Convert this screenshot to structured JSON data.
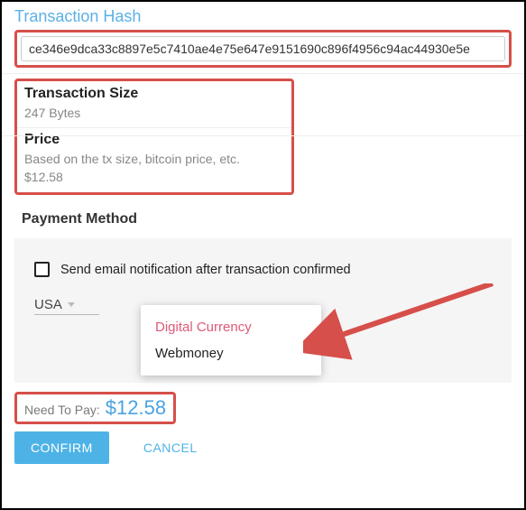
{
  "hash": {
    "label": "Transaction Hash",
    "value": "ce346e9dca33c8897e5c7410ae4e75e647e9151690c896f4956c94ac44930e5e"
  },
  "size": {
    "label": "Transaction Size",
    "value": "247 Bytes"
  },
  "price": {
    "label": "Price",
    "desc": "Based on the tx size, bitcoin price, etc.",
    "value": "$12.58"
  },
  "payment_method": {
    "label": "Payment Method",
    "checkbox_label": "Send email notification after transaction confirmed",
    "country": "USA",
    "options": [
      "Digital Currency",
      "Webmoney"
    ],
    "selected": "Digital Currency"
  },
  "need_pay": {
    "label": "Need To Pay:",
    "value": "$12.58"
  },
  "buttons": {
    "confirm": "CONFIRM",
    "cancel": "CANCEL"
  }
}
